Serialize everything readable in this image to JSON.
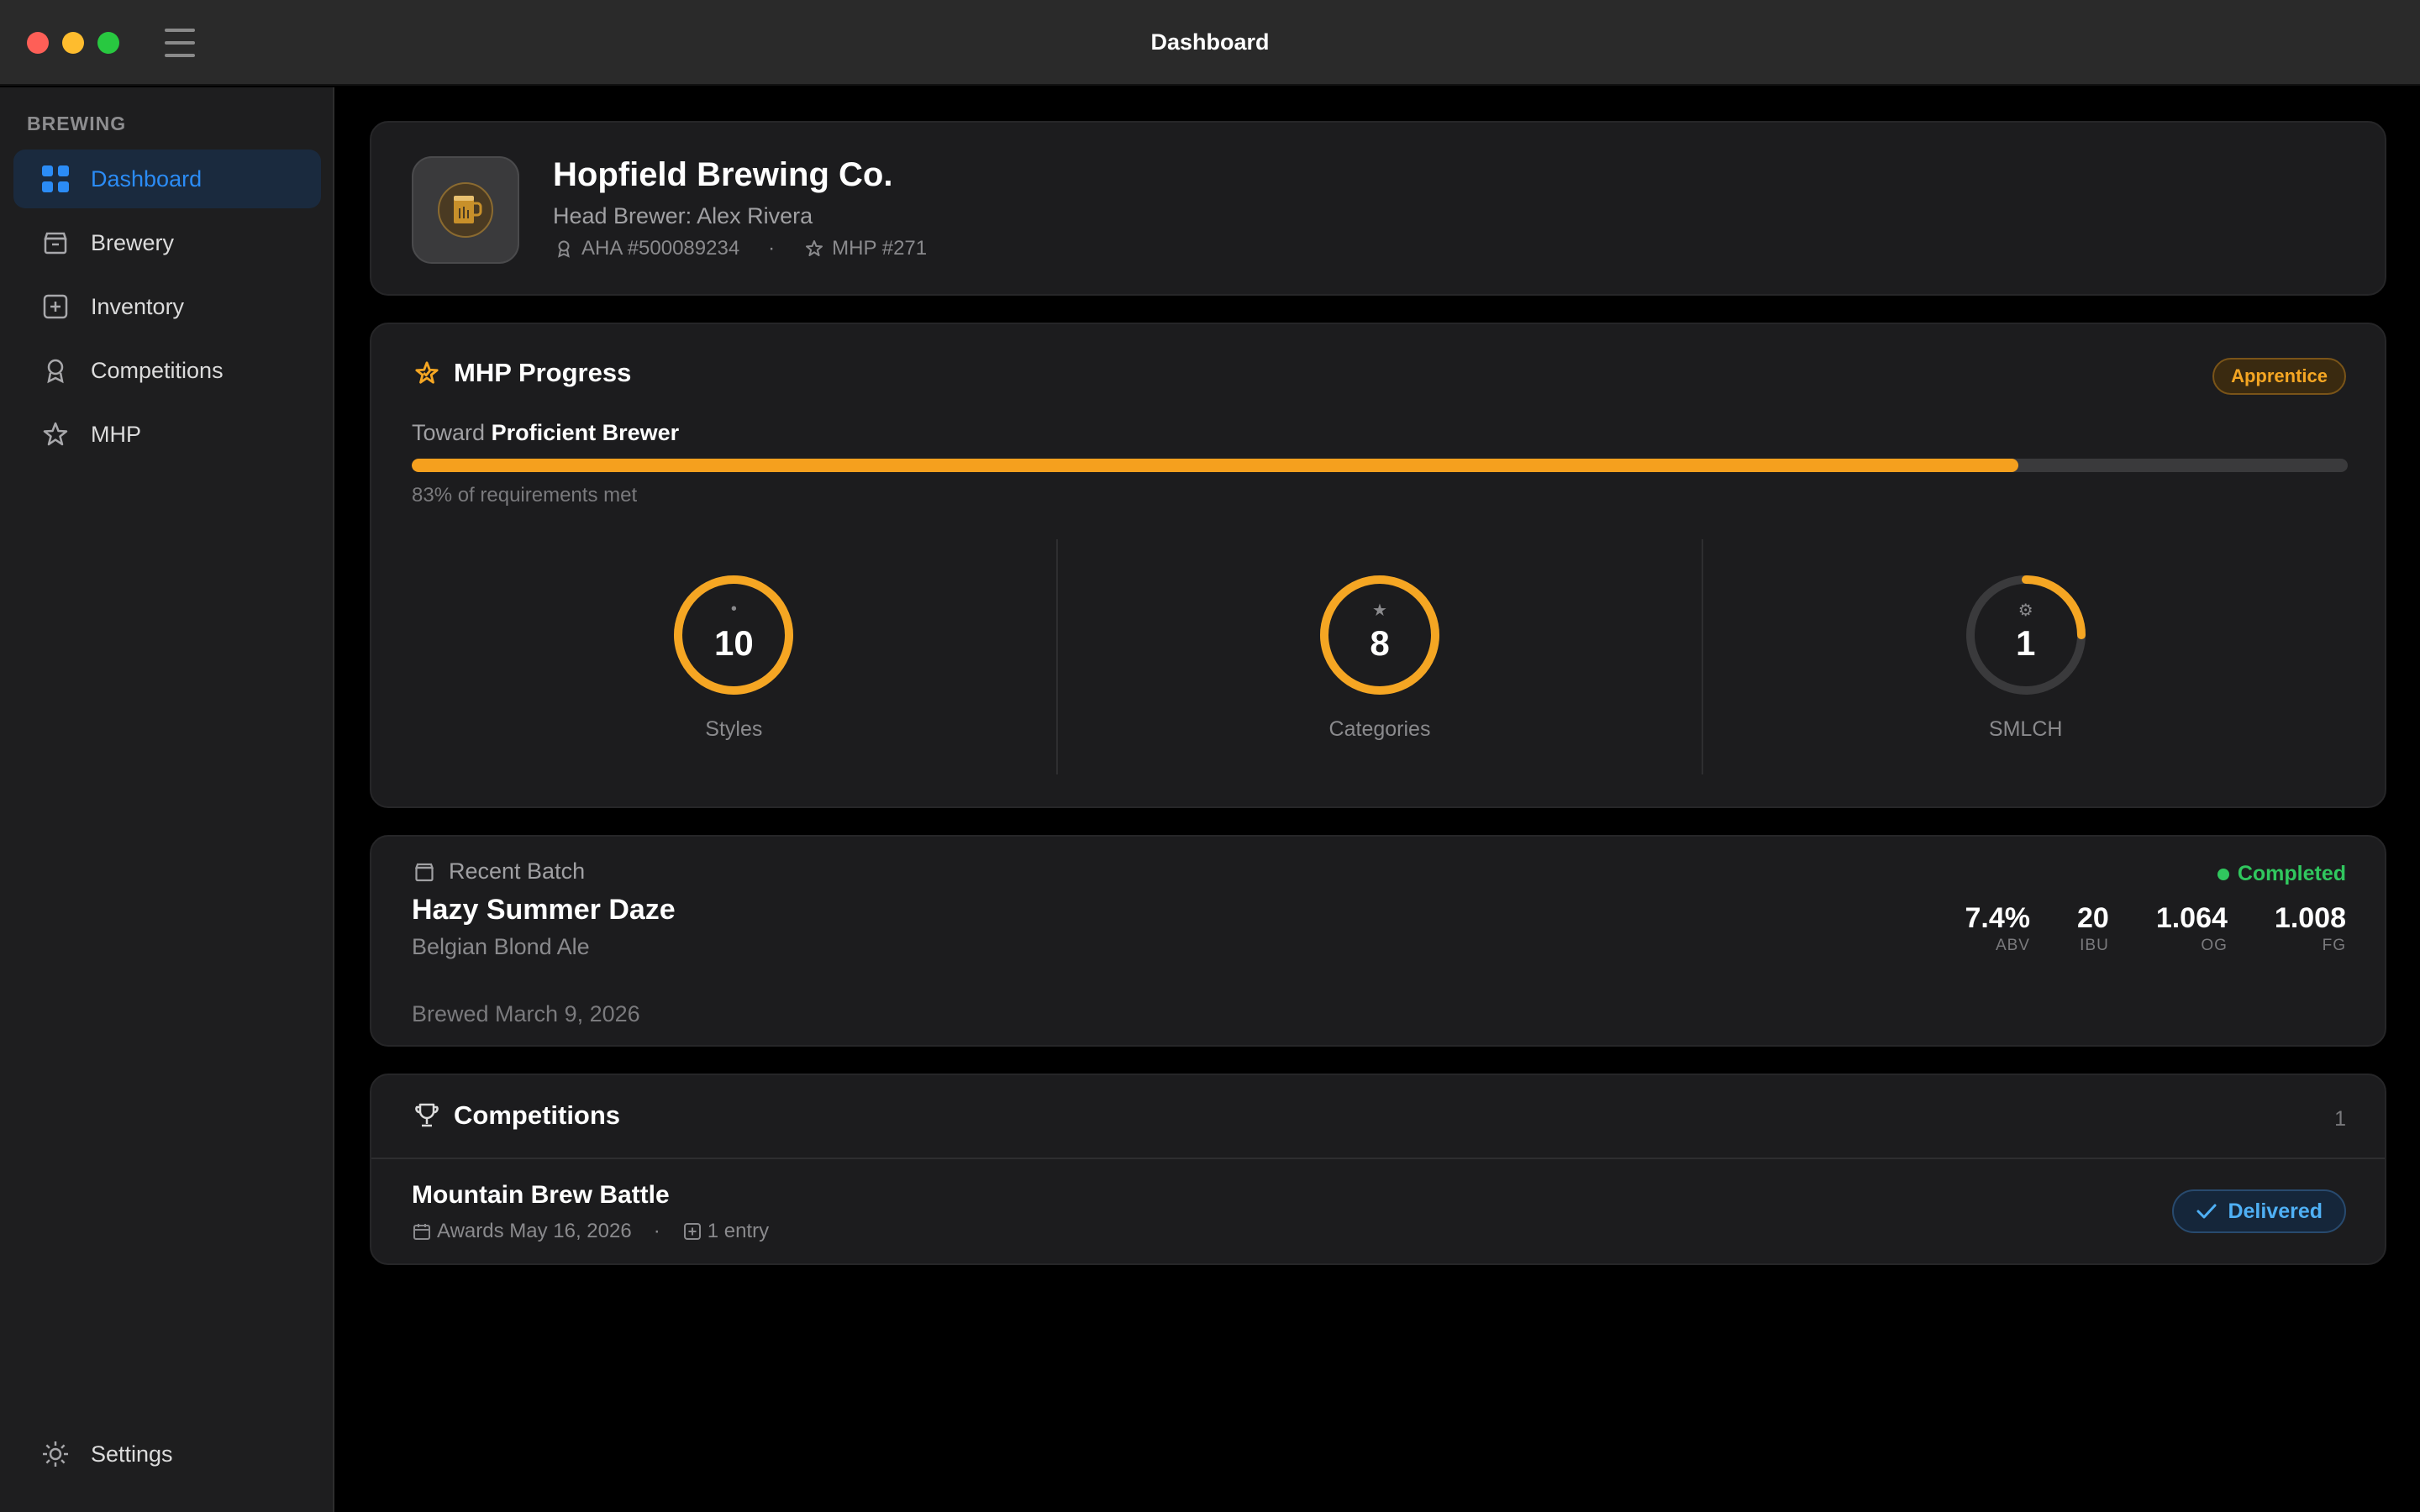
{
  "window": {
    "title": "Dashboard"
  },
  "sidebar": {
    "section_label": "BREWING",
    "items": [
      {
        "label": "Dashboard",
        "icon": "grid-icon",
        "active": true
      },
      {
        "label": "Brewery",
        "icon": "archive-box-icon",
        "active": false
      },
      {
        "label": "Inventory",
        "icon": "plus-square-icon",
        "active": false
      },
      {
        "label": "Competitions",
        "icon": "award-ribbon-icon",
        "active": false
      },
      {
        "label": "MHP",
        "icon": "star-outline-icon",
        "active": false
      }
    ],
    "settings_label": "Settings"
  },
  "profile": {
    "name": "Hopfield Brewing Co.",
    "head_brewer": "Head Brewer: Alex Rivera",
    "aha_number": "AHA #500089234",
    "separator": "·",
    "mhp_number": "MHP #271"
  },
  "mhp": {
    "title": "MHP Progress",
    "rank_badge": "Apprentice",
    "toward_prefix": "Toward",
    "toward_target": "Proficient Brewer",
    "progress_percent": 83,
    "requirements_text": "83% of requirements met",
    "gauges": [
      {
        "value": "10",
        "label": "Styles",
        "glyph": "•",
        "fraction": 1.0
      },
      {
        "value": "8",
        "label": "Categories",
        "glyph": "★",
        "fraction": 1.0
      },
      {
        "value": "1",
        "label": "SMLCH",
        "glyph": "⚙",
        "fraction": 0.25
      }
    ]
  },
  "batch": {
    "header": "Recent Batch",
    "name": "Hazy Summer Daze",
    "style": "Belgian Blond Ale",
    "brewed": "Brewed March 9, 2026",
    "status": "Completed",
    "stats": [
      {
        "value": "7.4%",
        "label": "ABV"
      },
      {
        "value": "20",
        "label": "IBU"
      },
      {
        "value": "1.064",
        "label": "OG"
      },
      {
        "value": "1.008",
        "label": "FG"
      }
    ]
  },
  "competitions": {
    "title": "Competitions",
    "count": "1",
    "entry": {
      "name": "Mountain Brew Battle",
      "awards": "Awards May 16, 2026",
      "separator": "·",
      "entries": "1 entry",
      "status": "Delivered"
    }
  },
  "colors": {
    "accent_blue": "#2b8cf6",
    "accent_orange": "#f5a623",
    "success_green": "#30c75e"
  }
}
